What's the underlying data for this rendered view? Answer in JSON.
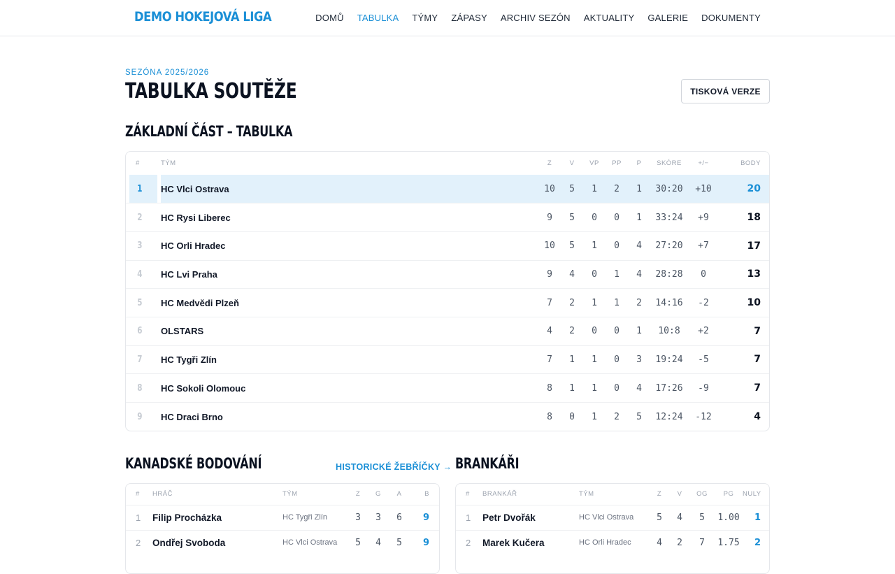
{
  "header": {
    "brand": "DEMO HOKEJOVÁ LIGA",
    "nav": [
      {
        "label": "DOMŮ",
        "active": false
      },
      {
        "label": "TABULKA",
        "active": true
      },
      {
        "label": "TÝMY",
        "active": false
      },
      {
        "label": "ZÁPASY",
        "active": false
      },
      {
        "label": "ARCHIV SEZÓN",
        "active": false
      },
      {
        "label": "AKTUALITY",
        "active": false
      },
      {
        "label": "GALERIE",
        "active": false
      },
      {
        "label": "DOKUMENTY",
        "active": false
      }
    ]
  },
  "page": {
    "eyebrow": "SEZÓNA 2025/2026",
    "title": "TABULKA SOUTĚŽE",
    "print_label": "TISKOVÁ VERZE"
  },
  "standings": {
    "title": "ZÁKLADNÍ ČÁST – TABULKA",
    "columns": [
      "#",
      "TÝM",
      "Z",
      "V",
      "VP",
      "PP",
      "P",
      "SKÓRE",
      "+/−",
      "BODY"
    ],
    "rows": [
      {
        "rank": "1",
        "team": "HC Vlci Ostrava",
        "z": "10",
        "v": "5",
        "vp": "1",
        "pp": "2",
        "p": "1",
        "score": "30:20",
        "diff": "+10",
        "pts": "20"
      },
      {
        "rank": "2",
        "team": "HC Rysi Liberec",
        "z": "9",
        "v": "5",
        "vp": "0",
        "pp": "0",
        "p": "1",
        "score": "33:24",
        "diff": "+9",
        "pts": "18"
      },
      {
        "rank": "3",
        "team": "HC Orli Hradec",
        "z": "10",
        "v": "5",
        "vp": "1",
        "pp": "0",
        "p": "4",
        "score": "27:20",
        "diff": "+7",
        "pts": "17"
      },
      {
        "rank": "4",
        "team": "HC Lvi Praha",
        "z": "9",
        "v": "4",
        "vp": "0",
        "pp": "1",
        "p": "4",
        "score": "28:28",
        "diff": "0",
        "pts": "13"
      },
      {
        "rank": "5",
        "team": "HC Medvědi Plzeň",
        "z": "7",
        "v": "2",
        "vp": "1",
        "pp": "1",
        "p": "2",
        "score": "14:16",
        "diff": "-2",
        "pts": "10"
      },
      {
        "rank": "6",
        "team": "OLSTARS",
        "z": "4",
        "v": "2",
        "vp": "0",
        "pp": "0",
        "p": "1",
        "score": "10:8",
        "diff": "+2",
        "pts": "7"
      },
      {
        "rank": "7",
        "team": "HC Tygři Zlín",
        "z": "7",
        "v": "1",
        "vp": "1",
        "pp": "0",
        "p": "3",
        "score": "19:24",
        "diff": "-5",
        "pts": "7"
      },
      {
        "rank": "8",
        "team": "HC Sokoli Olomouc",
        "z": "8",
        "v": "1",
        "vp": "1",
        "pp": "0",
        "p": "4",
        "score": "17:26",
        "diff": "-9",
        "pts": "7"
      },
      {
        "rank": "9",
        "team": "HC Draci Brno",
        "z": "8",
        "v": "0",
        "vp": "1",
        "pp": "2",
        "p": "5",
        "score": "12:24",
        "diff": "-12",
        "pts": "4"
      }
    ]
  },
  "scorers": {
    "title": "KANADSKÉ BODOVÁNÍ",
    "link": "HISTORICKÉ ŽEBŘÍČKY →",
    "columns": [
      "#",
      "HRÁČ",
      "TÝM",
      "Z",
      "G",
      "A",
      "B"
    ],
    "rows": [
      {
        "rank": "1",
        "player": "Filip Procházka",
        "team": "HC Tygři Zlín",
        "z": "3",
        "g": "3",
        "a": "6",
        "b": "9"
      },
      {
        "rank": "2",
        "player": "Ondřej Svoboda",
        "team": "HC Vlci Ostrava",
        "z": "5",
        "g": "4",
        "a": "5",
        "b": "9"
      }
    ]
  },
  "goalies": {
    "title": "BRANKÁŘI",
    "columns": [
      "#",
      "BRANKÁŘ",
      "TÝM",
      "Z",
      "V",
      "OG",
      "PG",
      "NULY"
    ],
    "rows": [
      {
        "rank": "1",
        "player": "Petr Dvořák",
        "team": "HC Vlci Ostrava",
        "z": "5",
        "v": "4",
        "og": "5",
        "pg": "1.00",
        "nuly": "1"
      },
      {
        "rank": "2",
        "player": "Marek Kučera",
        "team": "HC Orli Hradec",
        "z": "4",
        "v": "2",
        "og": "7",
        "pg": "1.75",
        "nuly": "2"
      }
    ]
  },
  "colors": {
    "accent": "#1a8fd6",
    "leader_row": "#e2f1fb"
  }
}
